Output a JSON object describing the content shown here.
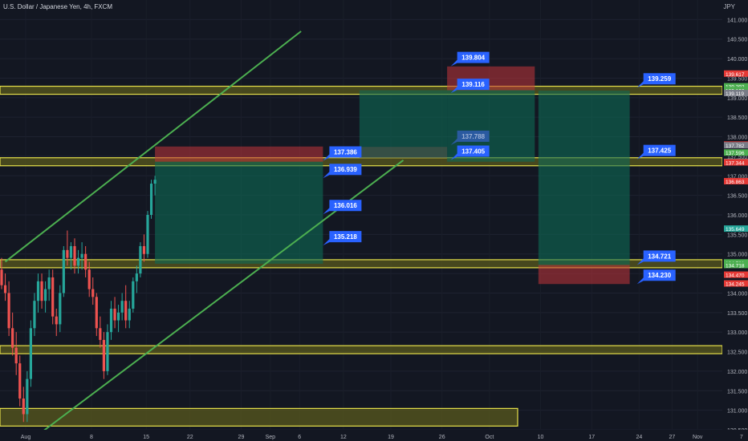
{
  "header": {
    "symbol": "U.S. Dollar / Japanese Yen, 4h, FXCM",
    "currency": "JPY"
  },
  "chart_data": {
    "type": "candlestick",
    "ylim": [
      130.5,
      141.5
    ],
    "y_ticks": [
      "141.000",
      "140.500",
      "140.000",
      "139.500",
      "139.000",
      "138.500",
      "138.000",
      "137.500",
      "137.000",
      "136.500",
      "136.000",
      "135.500",
      "135.000",
      "134.500",
      "134.000",
      "133.500",
      "133.000",
      "132.500",
      "132.000",
      "131.500",
      "131.000",
      "130.500"
    ],
    "x_ticks": [
      "Aug",
      "8",
      "15",
      "22",
      "29",
      "Sep",
      "6",
      "12",
      "19",
      "26",
      "Oct",
      "10",
      "17",
      "24",
      "27",
      "Nov",
      "7"
    ],
    "zones": [
      139.19,
      137.36,
      134.75,
      132.55,
      130.8
    ],
    "trend_lines": [
      {
        "p1": [
          1,
          134.8
        ],
        "p2": [
          82,
          140.7
        ],
        "color": "#4caf50"
      },
      {
        "p1": [
          9,
          130.3
        ],
        "p2": [
          110,
          137.4
        ],
        "color": "#4caf50"
      }
    ],
    "positions": [
      {
        "x1": 42,
        "x2": 88,
        "entry": 137.36,
        "stop": 137.75,
        "target": 134.75
      },
      {
        "x1": 98,
        "x2": 122,
        "entry": 137.46,
        "stop": 137.74,
        "target": 139.19
      },
      {
        "x1": 122,
        "x2": 146,
        "entry": 139.19,
        "stop": 139.8,
        "target": 137.36
      },
      {
        "x1": 147,
        "x2": 172,
        "entry": 134.72,
        "stop": 134.23,
        "target": 139.18
      }
    ],
    "callouts": [
      {
        "x": 123,
        "y": 139.804,
        "label": "139.804"
      },
      {
        "x": 123,
        "y": 139.116,
        "label": "139.116"
      },
      {
        "x": 123,
        "y": 137.788,
        "label": "137.788",
        "muted": true
      },
      {
        "x": 123,
        "y": 137.405,
        "label": "137.405"
      },
      {
        "x": 88,
        "y": 137.386,
        "label": "137.386"
      },
      {
        "x": 88,
        "y": 136.939,
        "label": "136.939"
      },
      {
        "x": 88,
        "y": 136.016,
        "label": "136.016"
      },
      {
        "x": 88,
        "y": 135.218,
        "label": "135.218"
      },
      {
        "x": 174,
        "y": 139.259,
        "label": "139.259"
      },
      {
        "x": 174,
        "y": 137.425,
        "label": "137.425"
      },
      {
        "x": 174,
        "y": 134.721,
        "label": "134.721"
      },
      {
        "x": 174,
        "y": 134.23,
        "label": "134.230"
      }
    ],
    "price_labels": [
      {
        "v": 139.617,
        "label": "139.617",
        "color": "#e53935"
      },
      {
        "v": 139.292,
        "label": "139.292",
        "color": "#4caf50"
      },
      {
        "v": 139.196,
        "label": "139.196",
        "color": "#4caf50"
      },
      {
        "v": 139.119,
        "label": "139.119",
        "color": "#787b86"
      },
      {
        "v": 137.799,
        "label": "137.799",
        "color": "#e53935"
      },
      {
        "v": 137.782,
        "label": "137.782",
        "color": "#787b86"
      },
      {
        "v": 137.596,
        "label": "137.596",
        "color": "#4caf50"
      },
      {
        "v": 137.358,
        "label": "137.358",
        "color": "#787b86"
      },
      {
        "v": 137.344,
        "label": "137.344",
        "color": "#e53935"
      },
      {
        "v": 136.863,
        "label": "136.863",
        "color": "#e53935"
      },
      {
        "v": 135.649,
        "label": "135.649",
        "color": "#26a69a"
      },
      {
        "v": 134.782,
        "label": "134.782",
        "color": "#4caf50"
      },
      {
        "v": 134.781,
        "label": "134.781",
        "color": "#4caf50"
      },
      {
        "v": 134.718,
        "label": "134.718",
        "color": "#4caf50"
      },
      {
        "v": 134.47,
        "label": "134.470",
        "color": "#e53935"
      },
      {
        "v": 134.245,
        "label": "134.245",
        "color": "#e53935"
      }
    ],
    "candles": [
      [
        134.6,
        134.9,
        134.1,
        134.2
      ],
      [
        134.2,
        134.5,
        133.8,
        134.0
      ],
      [
        134.0,
        134.3,
        132.9,
        133.1
      ],
      [
        133.1,
        133.5,
        132.4,
        132.6
      ],
      [
        132.6,
        133.0,
        131.9,
        132.2
      ],
      [
        132.2,
        132.4,
        131.1,
        131.3
      ],
      [
        131.3,
        131.6,
        130.7,
        130.9
      ],
      [
        130.9,
        132.0,
        130.7,
        131.8
      ],
      [
        131.8,
        133.3,
        131.6,
        133.1
      ],
      [
        133.1,
        134.0,
        132.9,
        133.8
      ],
      [
        133.8,
        134.5,
        133.5,
        134.3
      ],
      [
        134.3,
        134.5,
        133.6,
        133.8
      ],
      [
        133.8,
        134.3,
        133.5,
        134.1
      ],
      [
        134.1,
        134.6,
        133.8,
        134.4
      ],
      [
        134.4,
        134.6,
        133.2,
        133.4
      ],
      [
        133.4,
        133.6,
        132.9,
        133.2
      ],
      [
        133.2,
        134.2,
        133.0,
        134.0
      ],
      [
        134.0,
        135.2,
        133.9,
        135.1
      ],
      [
        135.1,
        135.6,
        134.7,
        134.9
      ],
      [
        134.9,
        135.3,
        134.6,
        135.2
      ],
      [
        135.2,
        135.4,
        134.5,
        134.7
      ],
      [
        134.7,
        135.1,
        134.5,
        134.9
      ],
      [
        134.9,
        135.3,
        134.6,
        135.0
      ],
      [
        135.0,
        135.2,
        134.4,
        134.6
      ],
      [
        134.6,
        134.8,
        133.9,
        134.1
      ],
      [
        134.1,
        134.4,
        133.7,
        133.9
      ],
      [
        133.9,
        134.0,
        132.9,
        133.1
      ],
      [
        133.1,
        133.4,
        132.6,
        132.8
      ],
      [
        132.8,
        133.0,
        131.8,
        132.0
      ],
      [
        132.0,
        133.2,
        131.9,
        133.0
      ],
      [
        133.0,
        133.8,
        132.8,
        133.6
      ],
      [
        133.6,
        133.9,
        133.1,
        133.3
      ],
      [
        133.3,
        133.7,
        133.0,
        133.5
      ],
      [
        133.5,
        134.0,
        133.3,
        133.8
      ],
      [
        133.8,
        134.2,
        133.1,
        133.3
      ],
      [
        133.3,
        133.8,
        133.1,
        133.6
      ],
      [
        133.6,
        134.4,
        133.5,
        134.3
      ],
      [
        134.3,
        134.7,
        134.0,
        134.5
      ],
      [
        134.5,
        135.3,
        134.4,
        135.2
      ],
      [
        135.2,
        135.5,
        134.8,
        135.0
      ],
      [
        135.0,
        136.1,
        134.9,
        136.0
      ],
      [
        136.0,
        136.9,
        135.9,
        136.8
      ],
      [
        136.8,
        137.0,
        136.5,
        136.9
      ]
    ]
  }
}
